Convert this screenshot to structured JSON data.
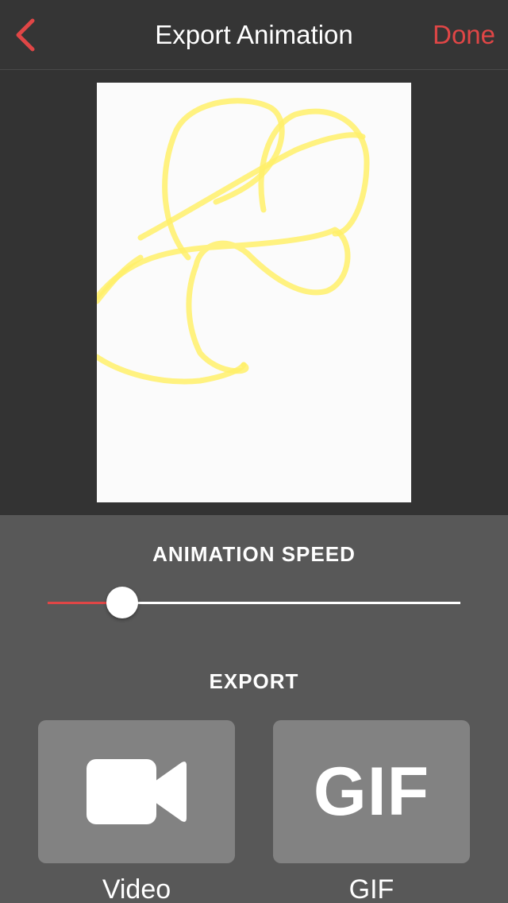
{
  "nav": {
    "title": "Export Animation",
    "done_label": "Done",
    "back_icon": "chevron-left-icon"
  },
  "preview": {
    "content": "yellow-scribble-drawing",
    "stroke_color": "#fff06a"
  },
  "speed": {
    "label": "ANIMATION SPEED",
    "value": 0.18
  },
  "export": {
    "label": "EXPORT",
    "options": [
      {
        "icon": "video-camera-icon",
        "caption": "Video"
      },
      {
        "icon": "gif-icon",
        "glyph": "GIF",
        "caption": "GIF"
      }
    ]
  },
  "colors": {
    "accent": "#e04646",
    "nav_bg": "#353535",
    "panel_bg": "#585858",
    "tile_bg": "#828282"
  }
}
